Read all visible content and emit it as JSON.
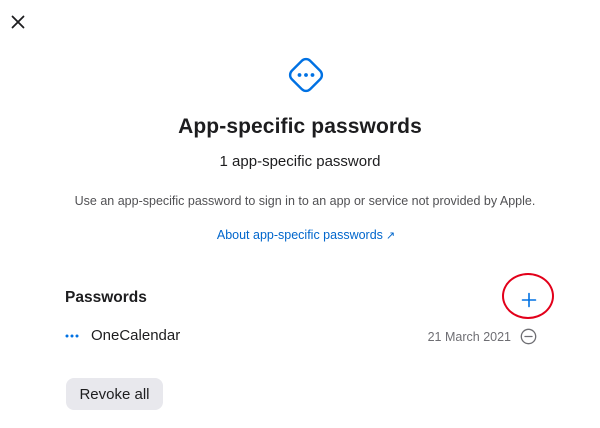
{
  "close_icon": "close-icon",
  "header": {
    "icon": "app-specific-password-icon",
    "title": "App-specific passwords",
    "subtitle": "1 app-specific password",
    "description": "Use an app-specific password to sign in to an app or service not provided by Apple.",
    "about_link": "About app-specific passwords",
    "about_link_icon": "external-arrow-icon"
  },
  "passwords": {
    "section_title": "Passwords",
    "add_icon": "plus-icon",
    "items": [
      {
        "name": "OneCalendar",
        "date": "21 March 2021",
        "icon": "more-dots-icon",
        "remove_icon": "minus-circle-icon"
      }
    ]
  },
  "revoke_all_label": "Revoke all",
  "colors": {
    "accent": "#0066cc",
    "highlight": "#e2001a",
    "button_bg": "#e8e8ed",
    "text": "#1d1d1f",
    "secondary_text": "#6e6e73"
  }
}
